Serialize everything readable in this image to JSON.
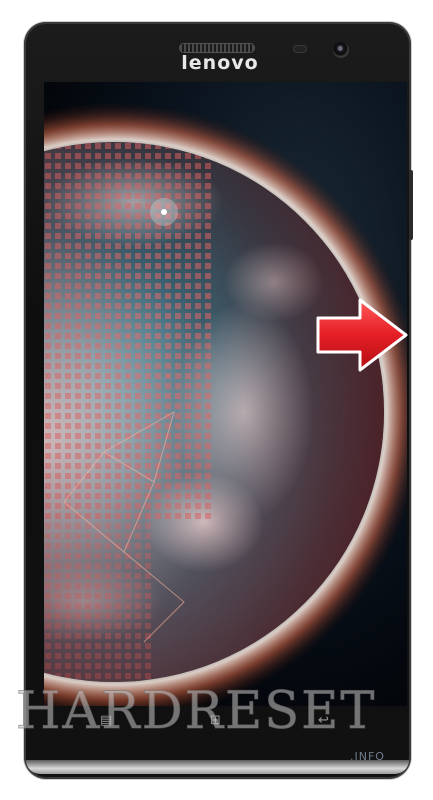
{
  "device": {
    "brand_logo": "lenovo",
    "body_color": "#141414",
    "accent_arrow_color": "#e41e25"
  },
  "screen": {
    "wallpaper": "earth-globe-wallpaper"
  },
  "navigation_keys": [
    {
      "name": "menu-key",
      "icon": "menu-icon",
      "glyph": "▤"
    },
    {
      "name": "home-key",
      "icon": "home-icon",
      "glyph": "⊞"
    },
    {
      "name": "back-key",
      "icon": "back-icon",
      "glyph": "↩"
    }
  ],
  "indicator": {
    "icon": "arrow-right-icon",
    "target": "power-button"
  },
  "watermark": {
    "main": "HARDRESET",
    "sub": ".INFO"
  }
}
